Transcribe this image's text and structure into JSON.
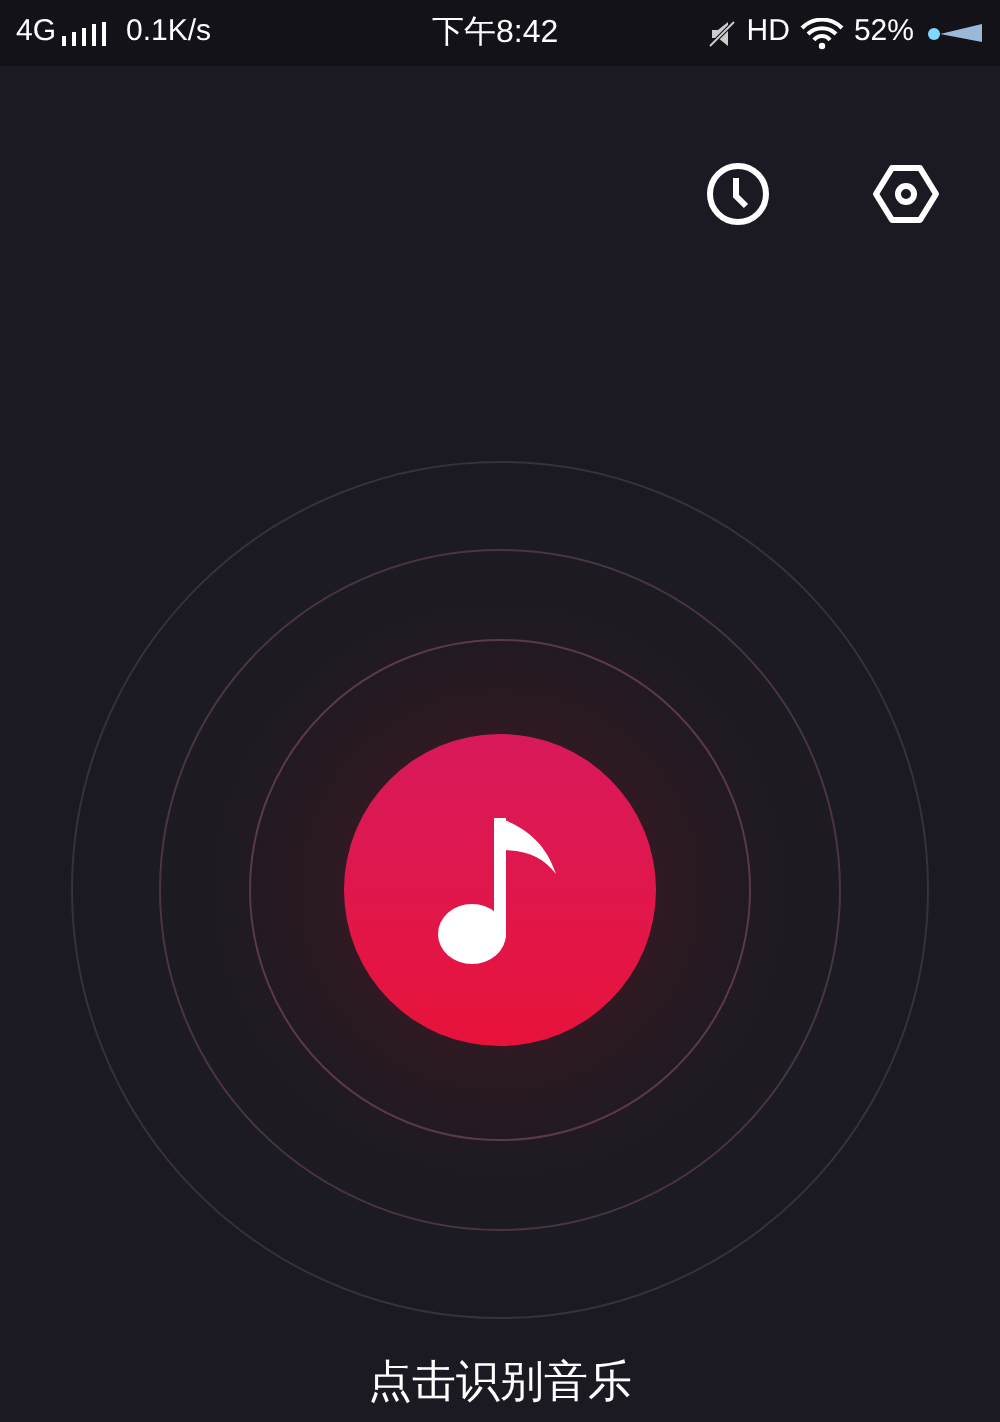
{
  "status_bar": {
    "network": "4G",
    "speed": "0.1K/s",
    "time": "下午8:42",
    "hd": "HD",
    "battery": "52%"
  },
  "prompt": "点击识别音乐"
}
